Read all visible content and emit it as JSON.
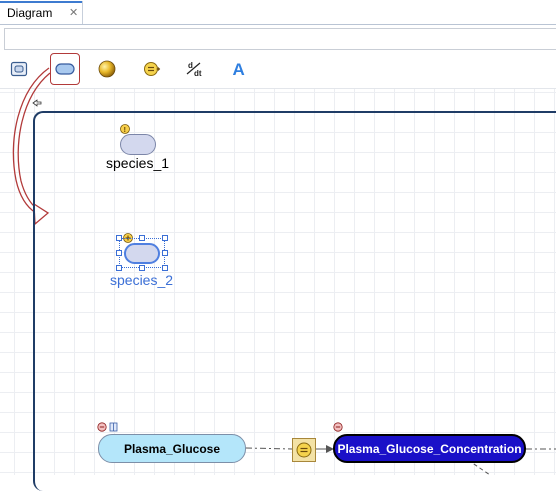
{
  "tab": {
    "label": "Diagram",
    "close_icon": "close-icon"
  },
  "toolbar": {
    "tools": [
      {
        "name": "compartment-tool",
        "icon": "compartment-icon"
      },
      {
        "name": "species-tool",
        "icon": "species-icon",
        "selected": true
      },
      {
        "name": "reaction-tool",
        "icon": "reaction-icon"
      },
      {
        "name": "reaction-rule-tool",
        "icon": "reaction-rule-icon"
      },
      {
        "name": "rate-rule-tool",
        "icon": "rate-rule-icon",
        "label": "d/dt"
      },
      {
        "name": "text-tool",
        "icon": "text-icon",
        "label": "A"
      }
    ]
  },
  "diagram": {
    "species_1": {
      "label": "species_1"
    },
    "species_2": {
      "label": "species_2",
      "selected": true
    },
    "plasma_glucose": {
      "label": "Plasma_Glucose",
      "color": "#b4e6fa"
    },
    "plasma_glucose_concentration": {
      "label": "Plasma_Glucose_Concentration",
      "color": "#1a10c8"
    }
  },
  "colors": {
    "accent": "#3b6fd6",
    "compartment_border": "#1f3c66",
    "highlight": "#b23a3a"
  }
}
